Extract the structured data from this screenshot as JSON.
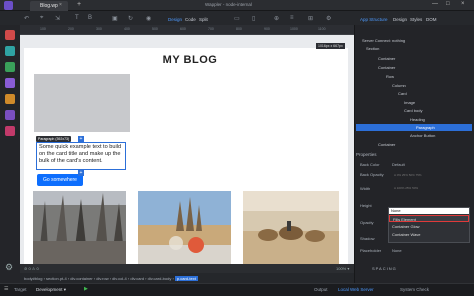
{
  "window": {
    "tab": "Blog.wp",
    "title": "Wappler - node-internal",
    "controls": [
      "—",
      "□",
      "×"
    ]
  },
  "modes": {
    "design": "Design",
    "code": "Code",
    "split": "Split",
    "app_structure": "App Structure",
    "design2": "Design",
    "styles": "Styles",
    "dom": "DOM"
  },
  "ruler": {
    "ticks": [
      "100",
      "200",
      "300",
      "400",
      "500",
      "600",
      "700",
      "800",
      "900",
      "1000",
      "1100"
    ],
    "size": "1016px x 667px"
  },
  "page": {
    "title": "MY BLOG",
    "para_tag": "Paragraph (392x73)",
    "card_text": "Some quick example text to build on the card title and make up the bulk of the card's content.",
    "button": "Go somewhere"
  },
  "canvas_status": {
    "left": "⊘ 0 ⚠ 0",
    "zoom": "100% ▾"
  },
  "breadcrumb": {
    "items": [
      "body#blog",
      "section.pt-4",
      "div.container",
      "div.row",
      "div.col-4",
      "div.card",
      "div.card-body"
    ],
    "active": "p.card-text"
  },
  "tree": [
    {
      "label": "Server Connect: nothing",
      "indent": 0
    },
    {
      "label": "Section",
      "indent": 0
    },
    {
      "label": "Container",
      "indent": 1
    },
    {
      "label": "Container",
      "indent": 1
    },
    {
      "label": "Row",
      "indent": 2
    },
    {
      "label": "Column",
      "indent": 3
    },
    {
      "label": "Card",
      "indent": 4
    },
    {
      "label": "Image",
      "indent": 5
    },
    {
      "label": "Card body",
      "indent": 5
    },
    {
      "label": "Heading",
      "indent": 6
    },
    {
      "label": "Paragraph",
      "indent": 6,
      "selected": true
    },
    {
      "label": "Anchor Button",
      "indent": 6
    },
    {
      "label": "Container",
      "indent": 1
    }
  ],
  "properties": {
    "header": "Properties",
    "back_color": "Back Color",
    "back_color_val": "Default",
    "back_opacity": "Back Opacity",
    "width": "Width",
    "height": "Height",
    "opacity": "Opacity",
    "shadow": "Shadow",
    "placeholder": "Placeholder",
    "placeholder_val": "None",
    "spacing": "SPACING",
    "scale": [
      "A",
      "0%",
      "25%",
      "50%",
      "75%",
      "100%",
      "25%",
      "50%"
    ]
  },
  "dropdown": {
    "value": "None",
    "options": [
      "Fills Element",
      "Container Glow",
      "Container Wave"
    ]
  },
  "bottom": {
    "output": "Output",
    "server": "Local Web Server",
    "check": "System Check",
    "target": "Target",
    "target_val": "Development ▾"
  }
}
